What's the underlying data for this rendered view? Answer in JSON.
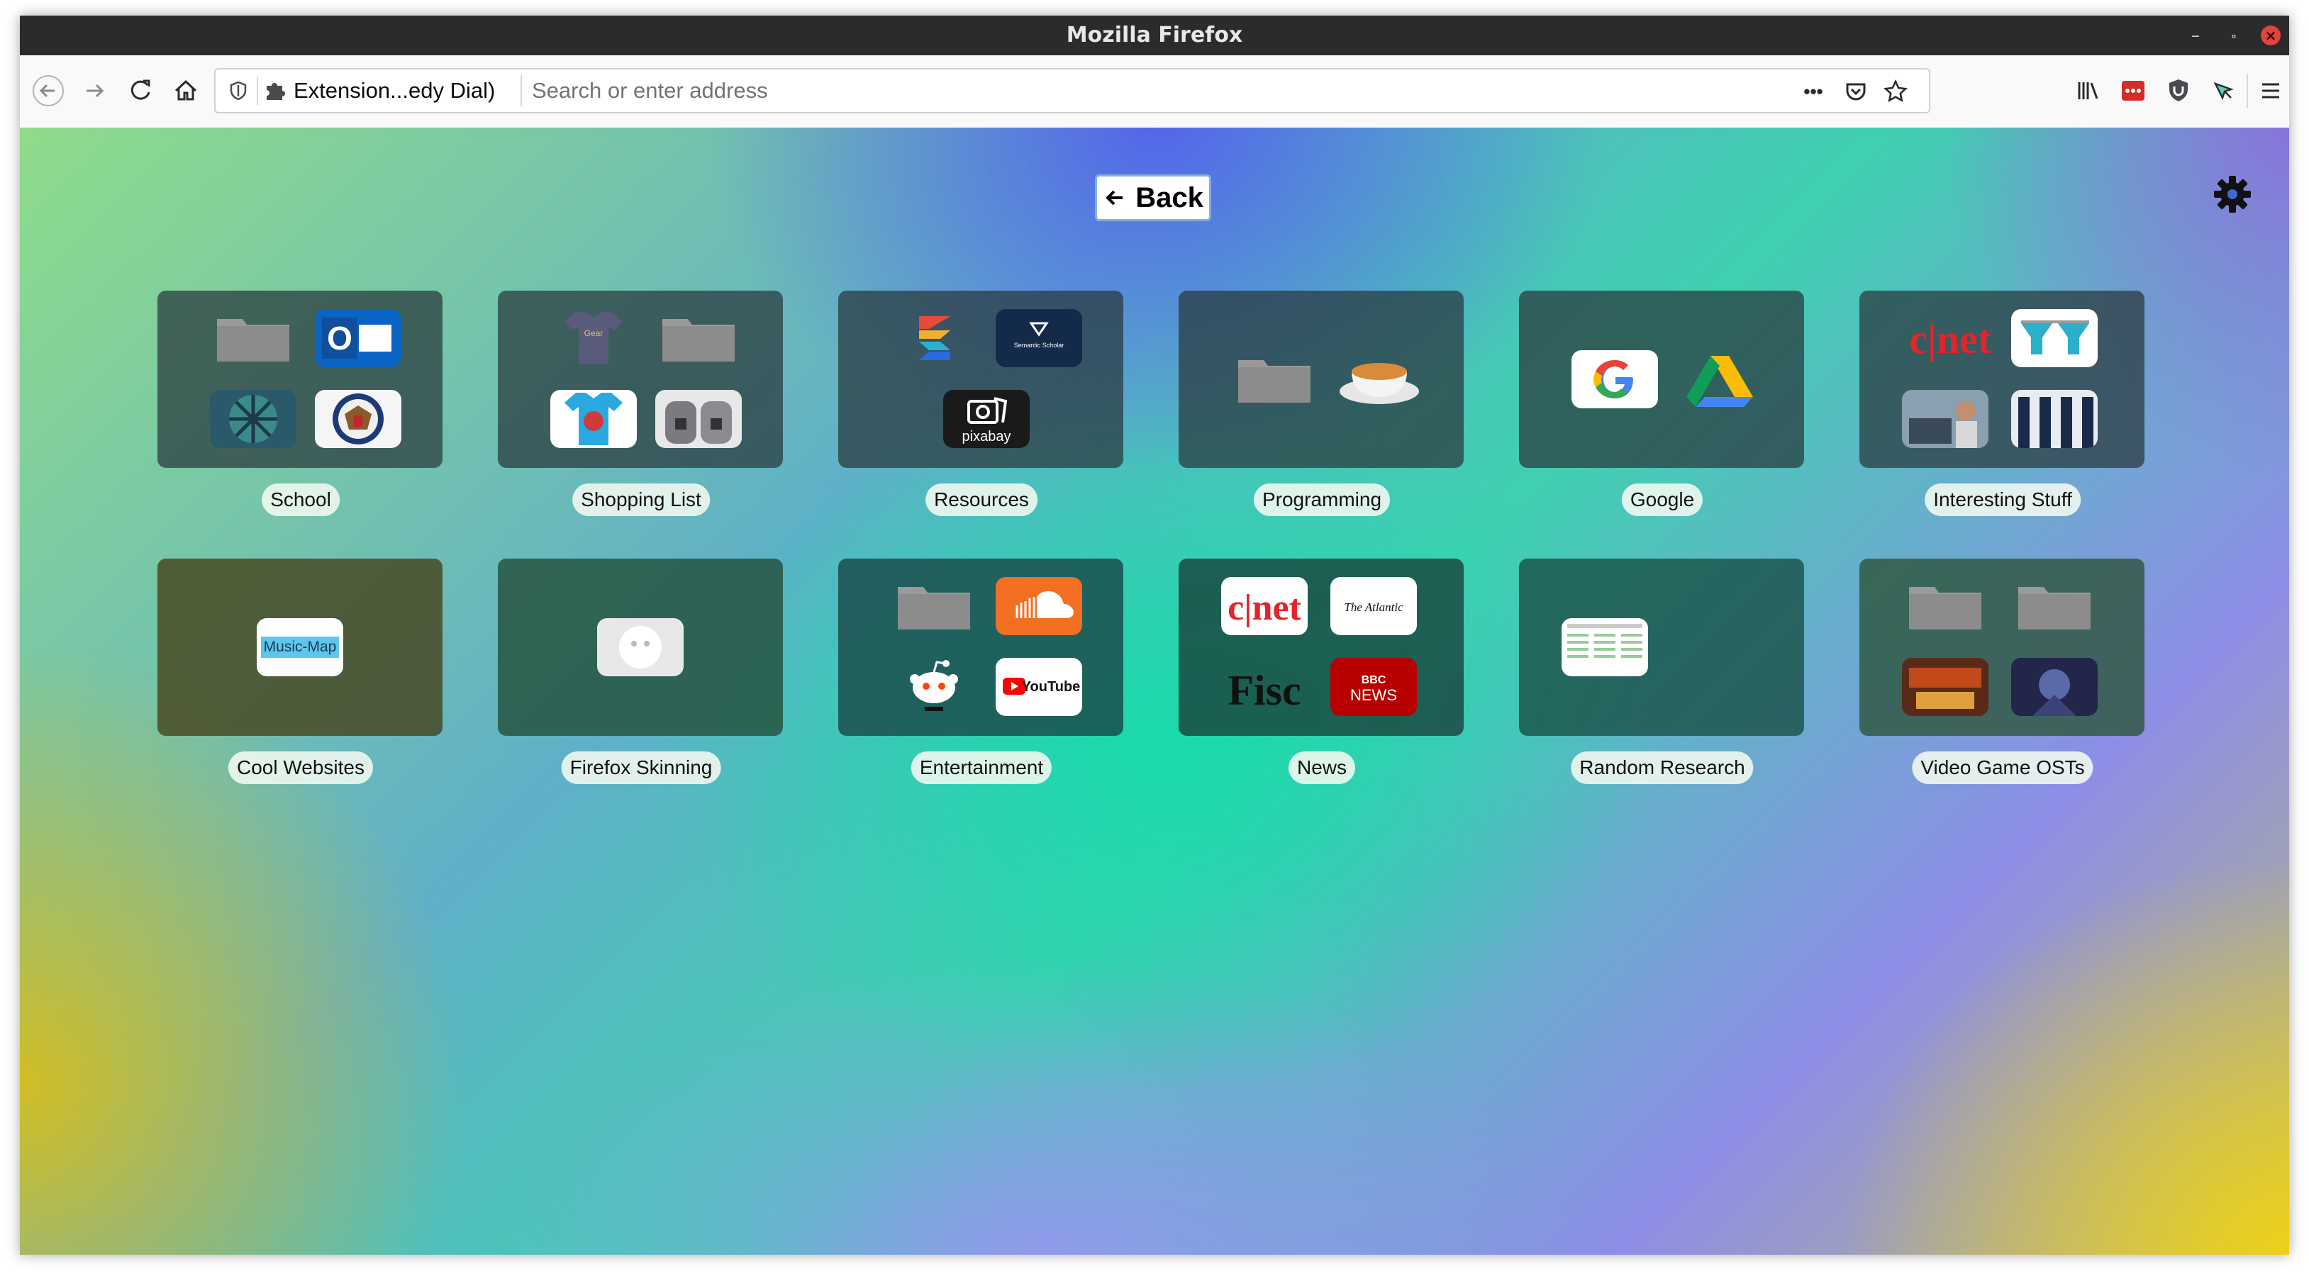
{
  "window": {
    "title": "Mozilla Firefox"
  },
  "navbar": {
    "identity_label": "Extension...edy Dial)",
    "address_placeholder": "Search or enter address",
    "more_label": "•••"
  },
  "page": {
    "back_label": "Back"
  },
  "folders": [
    {
      "name": "School"
    },
    {
      "name": "Shopping List"
    },
    {
      "name": "Resources"
    },
    {
      "name": "Programming"
    },
    {
      "name": "Google"
    },
    {
      "name": "Interesting Stuff"
    },
    {
      "name": "Cool Websites"
    },
    {
      "name": "Firefox Skinning"
    },
    {
      "name": "Entertainment"
    },
    {
      "name": "News"
    },
    {
      "name": "Random Research"
    },
    {
      "name": "Video Game OSTs"
    }
  ],
  "thumb_text": {
    "music_map": "Music-Map",
    "pixabay": "pixabay",
    "cnet": "c|net",
    "atlantic": "The Atlantic",
    "fisc": "Fisc",
    "bbc": "BBC",
    "bbc_news": "NEWS",
    "youtube": "YouTube",
    "semantic": "Semantic Scholar"
  },
  "colors": {
    "titlebar": "#2b2b2b",
    "close_button": "#e0443e",
    "tile_background": "rgba(40,55,60,0.72)"
  }
}
